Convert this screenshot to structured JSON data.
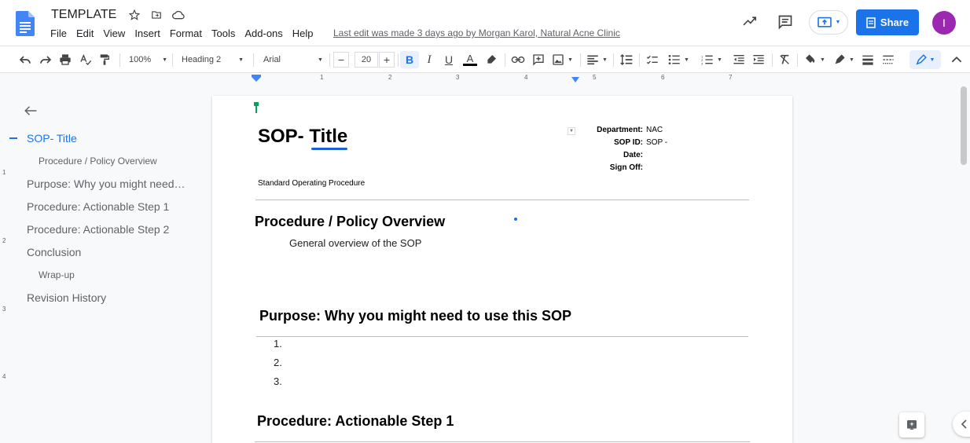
{
  "app": {
    "doc_title": "TEMPLATE",
    "last_edit": "Last edit was made 3 days ago by Morgan Karol, Natural Acne Clinic",
    "share_label": "Share",
    "avatar_initial": "I",
    "brand_color": "#1a73e8"
  },
  "menu": [
    "File",
    "Edit",
    "View",
    "Insert",
    "Format",
    "Tools",
    "Add-ons",
    "Help"
  ],
  "toolbar": {
    "zoom": "100%",
    "style": "Heading 2",
    "font": "Arial",
    "font_size": "20",
    "minus": "−",
    "plus": "+",
    "bold": "B",
    "italic": "I",
    "underline": "U",
    "text_color": "A"
  },
  "ruler": {
    "numbers": [
      "1",
      "1",
      "2",
      "3",
      "4",
      "5",
      "6",
      "7"
    ],
    "vertical_numbers": [
      "1",
      "2",
      "3",
      "4"
    ]
  },
  "outline": {
    "items": [
      {
        "label": "SOP- Title",
        "level": 1,
        "active": true
      },
      {
        "label": "Procedure / Policy Overview",
        "level": 2,
        "active": false
      },
      {
        "label": "Purpose: Why you might need…",
        "level": 1,
        "active": false
      },
      {
        "label": "Procedure: Actionable Step 1",
        "level": 1,
        "active": false
      },
      {
        "label": "Procedure: Actionable Step 2",
        "level": 1,
        "active": false
      },
      {
        "label": "Conclusion",
        "level": 1,
        "active": false
      },
      {
        "label": "Wrap-up",
        "level": 2,
        "active": false
      },
      {
        "label": "Revision History",
        "level": 1,
        "active": false
      }
    ]
  },
  "document": {
    "title_prefix": "SOP- ",
    "title_word": "Title",
    "subtitle": "Standard Operating Procedure",
    "meta": [
      {
        "label": "Department:",
        "value": "NAC"
      },
      {
        "label": "SOP ID:",
        "value": "SOP -"
      },
      {
        "label": "Date:",
        "value": ""
      },
      {
        "label": "Sign Off:",
        "value": ""
      }
    ],
    "overview_heading": "Procedure / Policy Overview",
    "overview_text": "General overview of the SOP",
    "purpose_heading": "Purpose: Why you might need to use this SOP",
    "list_items": [
      "1.",
      "2.",
      "3."
    ],
    "step1_heading": "Procedure: Actionable Step 1"
  }
}
